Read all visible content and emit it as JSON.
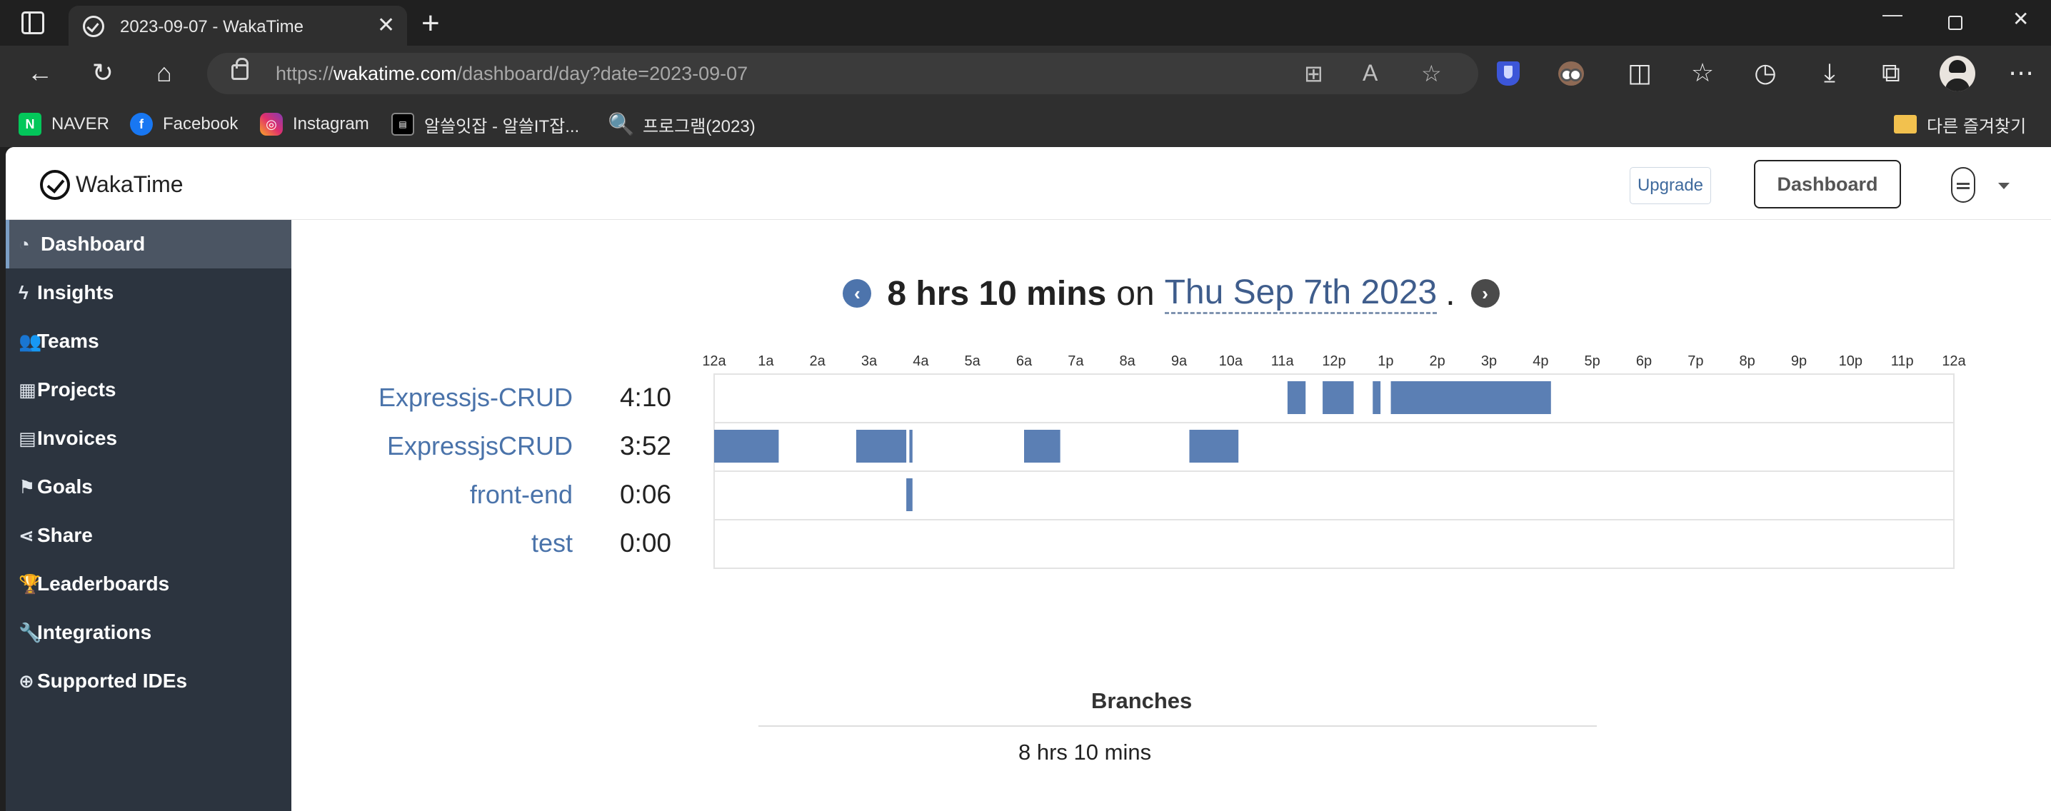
{
  "browser": {
    "tab_title": "2023-09-07 - WakaTime",
    "url_scheme": "https://",
    "url_host": "wakatime.com",
    "url_path": "/dashboard/day?date=2023-09-07",
    "bookmarks": [
      {
        "label": "NAVER",
        "icon": "naver-icon",
        "glyph": "N"
      },
      {
        "label": "Facebook",
        "icon": "facebook-icon",
        "glyph": "f"
      },
      {
        "label": "Instagram",
        "icon": "instagram-icon",
        "glyph": "◎"
      },
      {
        "label": "알쓸잇잡 - 알쓸IT잡...",
        "icon": "albong-icon",
        "glyph": "▤"
      },
      {
        "label": "프로그램(2023)",
        "icon": "search-icon",
        "glyph": "🔍"
      }
    ],
    "other_bookmarks": "다른 즐겨찾기"
  },
  "site": {
    "logo": "WakaTime",
    "upgrade": "Upgrade",
    "dashboard": "Dashboard"
  },
  "nav": {
    "items": [
      {
        "label": "Dashboard",
        "icon": "dashboard-icon",
        "glyph": "◔"
      },
      {
        "label": "Insights",
        "icon": "bolt-icon",
        "glyph": "ϟ"
      },
      {
        "label": "Teams",
        "icon": "users-icon",
        "glyph": "👥"
      },
      {
        "label": "Projects",
        "icon": "grid-icon",
        "glyph": "▦"
      },
      {
        "label": "Invoices",
        "icon": "document-icon",
        "glyph": "▤"
      },
      {
        "label": "Goals",
        "icon": "flag-icon",
        "glyph": "⚑"
      },
      {
        "label": "Share",
        "icon": "share-icon",
        "glyph": "⋖"
      },
      {
        "label": "Leaderboards",
        "icon": "trophy-icon",
        "glyph": "🏆"
      },
      {
        "label": "Integrations",
        "icon": "wrench-icon",
        "glyph": "🔧"
      },
      {
        "label": "Supported IDEs",
        "icon": "plus-circle-icon",
        "glyph": "⊕"
      }
    ]
  },
  "headline": {
    "total": "8 hrs 10 mins",
    "on": "on",
    "date": "Thu Sep 7th 2023",
    "dot": "."
  },
  "chart_data": {
    "type": "timeline",
    "x_ticks": [
      "12a",
      "1a",
      "2a",
      "3a",
      "4a",
      "5a",
      "6a",
      "7a",
      "8a",
      "9a",
      "10a",
      "11a",
      "12p",
      "1p",
      "2p",
      "3p",
      "4p",
      "5p",
      "6p",
      "7p",
      "8p",
      "9p",
      "10p",
      "11p",
      "12a"
    ],
    "x_range_hours": [
      0,
      24
    ],
    "bar_color": "#5b7fb4",
    "projects": [
      {
        "name": "Expressjs-CRUD",
        "time": "4:10",
        "segments": [
          [
            11.1,
            11.45
          ],
          [
            11.78,
            12.38
          ],
          [
            12.75,
            12.9
          ],
          [
            13.1,
            16.2
          ]
        ]
      },
      {
        "name": "ExpressjsCRUD",
        "time": "3:52",
        "segments": [
          [
            0.0,
            1.25
          ],
          [
            2.75,
            3.72
          ],
          [
            3.78,
            3.84
          ],
          [
            6.0,
            6.7
          ],
          [
            9.2,
            10.15
          ]
        ]
      },
      {
        "name": "front-end",
        "time": "0:06",
        "segments": [
          [
            3.72,
            3.84
          ]
        ]
      },
      {
        "name": "test",
        "time": "0:00",
        "segments": []
      }
    ]
  },
  "branches": {
    "title": "Branches",
    "total": "8 hrs 10 mins"
  }
}
